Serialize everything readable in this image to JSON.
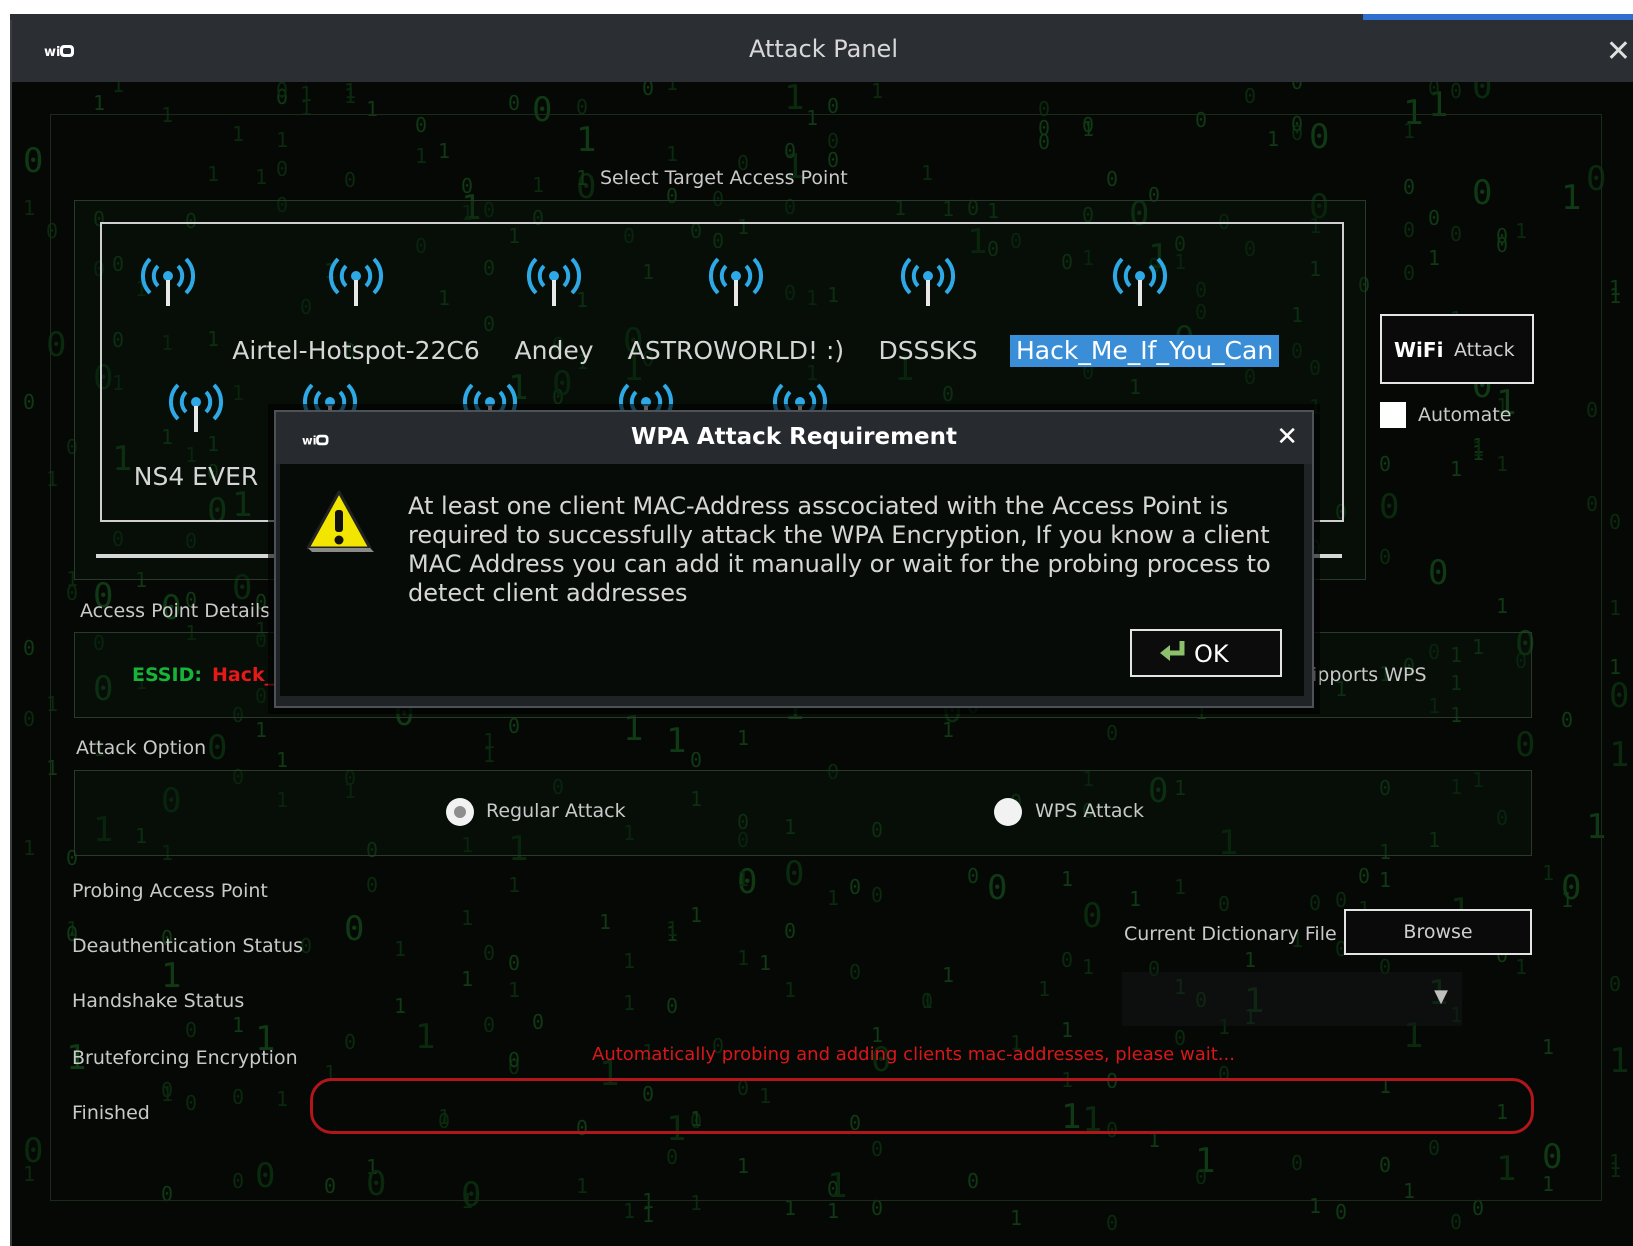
{
  "window": {
    "title": "Attack Panel",
    "app_icon": "wifi-logo-icon",
    "close_icon": "close-icon",
    "close_glyph": "✕"
  },
  "target": {
    "section_label": "Select Target Access Point",
    "access_points": [
      {
        "name": ""
      },
      {
        "name": "Airtel-Hotspot-22C6"
      },
      {
        "name": "Andey"
      },
      {
        "name": "ASTROWORLD! :)"
      },
      {
        "name": "DSSSKS"
      },
      {
        "name": "Hack_Me_If_You_Can",
        "selected": true
      },
      {
        "name": "NS4 EVER"
      },
      {
        "name": ""
      },
      {
        "name": ""
      },
      {
        "name": ""
      },
      {
        "name": ""
      }
    ],
    "icon": "wifi-antenna-icon",
    "icon_color": "#2fa8e6",
    "selected_color": "#3a8ed8"
  },
  "side": {
    "attack_label": "Attack",
    "attack_logo": "WiFi",
    "automate_label": "Automate"
  },
  "details": {
    "section_label": "Access Point Details",
    "essid_label": "ESSID:",
    "essid_value": "Hack_I",
    "supports_wps": "ipports WPS",
    "essid_label_color": "#18b43a",
    "essid_value_color": "#e81818"
  },
  "attack_option": {
    "section_label": "Attack Option",
    "regular": "Regular Attack",
    "wps": "WPS  Attack",
    "selected": "Regular Attack"
  },
  "status": {
    "probing": "Probing Access Point",
    "deauth": "Deauthentication Status",
    "handshake": "Handshake Status",
    "bruteforce": "Bruteforcing Encryption",
    "finished": "Finished",
    "message": "Automatically probing and adding clients mac-addresses, please wait...",
    "message_color": "#d81818"
  },
  "dictionary": {
    "label": "Current Dictionary File",
    "browse": "Browse",
    "dropdown_value": ""
  },
  "dialog": {
    "title": "WPA Attack Requirement",
    "close_glyph": "✕",
    "message": "At least one client MAC-Address asscociated with the Access Point is required to successfully attack the WPA Encryption, If you know a client MAC Address you can add it manually or wait for the probing process to detect client addresses",
    "ok": "OK",
    "icon": "warning-icon"
  }
}
